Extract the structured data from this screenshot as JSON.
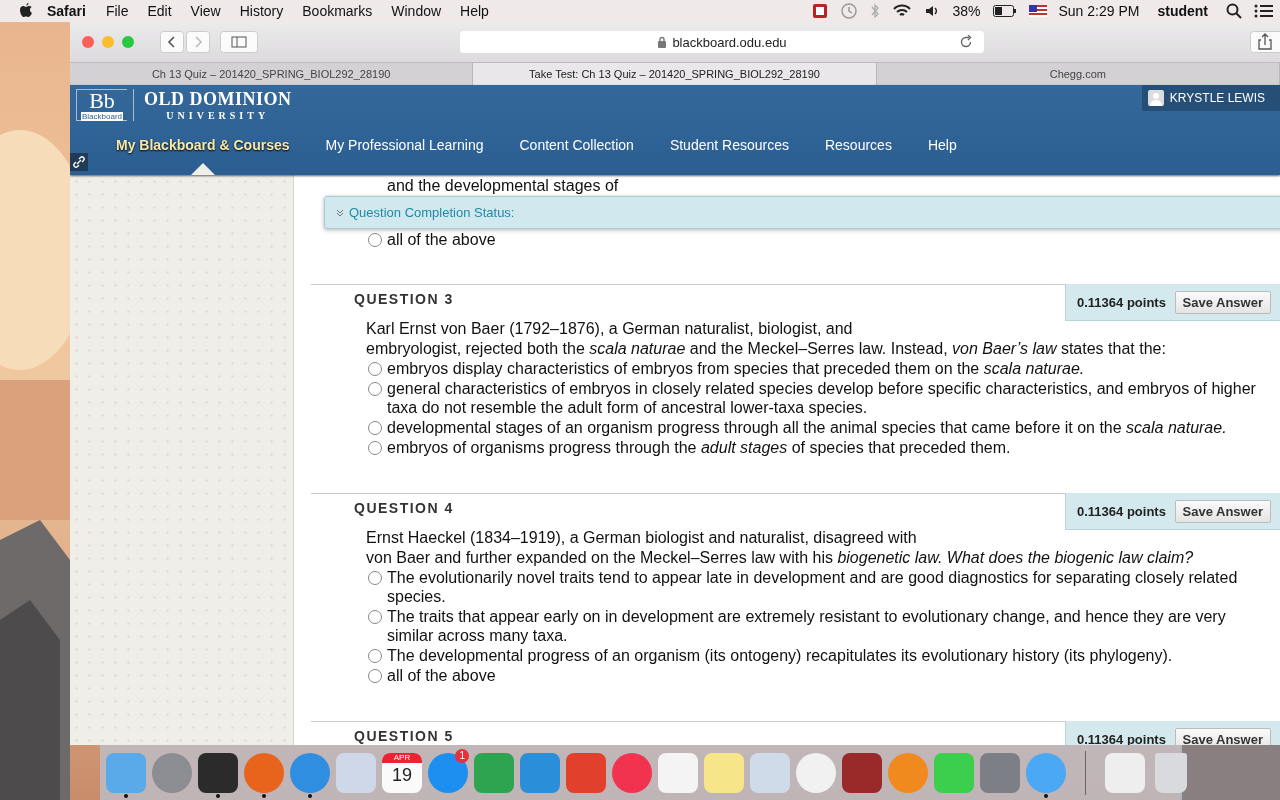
{
  "menu_bar": {
    "app": "Safari",
    "menus": [
      "File",
      "Edit",
      "View",
      "History",
      "Bookmarks",
      "Window",
      "Help"
    ],
    "battery": "38%",
    "clock": "Sun 2:29 PM",
    "user": "student"
  },
  "browser": {
    "address": "blackboard.odu.edu",
    "tabs": [
      {
        "label": "Ch 13 Quiz – 201420_SPRING_BIOL292_28190",
        "selected": false
      },
      {
        "label": "Take Test: Ch 13 Quiz – 201420_SPRING_BIOL292_28190",
        "selected": true
      },
      {
        "label": "Chegg.com",
        "selected": false
      }
    ]
  },
  "site_header": {
    "logo_mark": "Bb",
    "logo_caption": "Blackboard",
    "university": "OLD DOMINION",
    "university_line2": "UNIVERSITY",
    "user_name": "KRYSTLE LEWIS",
    "nav": [
      {
        "label": "My Blackboard & Courses",
        "selected": true
      },
      {
        "label": "My Professional Learning",
        "selected": false
      },
      {
        "label": "Content Collection",
        "selected": false
      },
      {
        "label": "Student Resources",
        "selected": false
      },
      {
        "label": "Resources",
        "selected": false
      },
      {
        "label": "Help",
        "selected": false
      }
    ]
  },
  "completion_banner": {
    "label": "Question Completion Status:"
  },
  "previous_question": {
    "fragment": "and the developmental stages of",
    "options": [
      {
        "text": "all of the above",
        "selected": false
      }
    ]
  },
  "questions": [
    {
      "title": "QUESTION 3",
      "points": "0.11364 points",
      "save_label": "Save Answer",
      "prompt": [
        "Karl Ernst von Baer (1792–1876), a German naturalist, biologist, and",
        "embryologist, rejected both the *scala naturae* and the Meckel–Serres law. Instead, *von Baer’s law* states that the:"
      ],
      "options": [
        {
          "text": "embryos display characteristics of embryos from species that preceded them on the *scala naturae.*",
          "selected": false
        },
        {
          "text": "general characteristics of embryos in closely related species develop before specific characteristics, and embryos of higher taxa do not resemble the adult form of ancestral lower-taxa species.",
          "selected": false
        },
        {
          "text": "developmental stages of an organism progress through all the animal species that came before it on the *scala naturae.*",
          "selected": false
        },
        {
          "text": "embryos of organisms progress through the *adult stages* of species that preceded them.",
          "selected": false
        }
      ]
    },
    {
      "title": "QUESTION 4",
      "points": "0.11364 points",
      "save_label": "Save Answer",
      "prompt": [
        "Ernst Haeckel (1834–1919), a German biologist and naturalist, disagreed with",
        "von Baer and further expanded on the Meckel–Serres law with his *biogenetic law. What does the biogenic law claim?*"
      ],
      "options": [
        {
          "text": "The evolutionarily novel traits tend to appear late in development and are good diagnostics for separating closely related species.",
          "selected": false
        },
        {
          "text": "The traits that appear early on in development are extremely resistant to evolutionary change, and hence they are very similar across many taxa.",
          "selected": false
        },
        {
          "text": "The developmental progress of an organism (its ontogeny) recapitulates its evolutionary history (its phylogeny).",
          "selected": false
        },
        {
          "text": "all of the above",
          "selected": false
        }
      ]
    },
    {
      "title": "QUESTION 5",
      "points": "0.11364 points",
      "save_label": "Save Answer"
    }
  ],
  "dock": {
    "items": [
      {
        "kind": "finder",
        "running": true
      },
      {
        "kind": "rocket",
        "running": false
      },
      {
        "kind": "dashboard",
        "running": true
      },
      {
        "kind": "firefox",
        "running": true
      },
      {
        "kind": "compass",
        "running": true
      },
      {
        "kind": "stamp",
        "running": false
      },
      {
        "kind": "calendar",
        "running": false,
        "month": "APR",
        "day": "19"
      },
      {
        "kind": "appstore",
        "running": false,
        "badge": "1"
      },
      {
        "kind": "green",
        "running": false
      },
      {
        "kind": "blue",
        "running": false
      },
      {
        "kind": "red",
        "running": false
      },
      {
        "kind": "music",
        "running": false
      },
      {
        "kind": "list",
        "running": false
      },
      {
        "kind": "notes",
        "running": false
      },
      {
        "kind": "preview",
        "running": false
      },
      {
        "kind": "photos",
        "running": false
      },
      {
        "kind": "photobooth",
        "running": false
      },
      {
        "kind": "book",
        "running": false
      },
      {
        "kind": "facetime",
        "running": false
      },
      {
        "kind": "gear",
        "running": false
      },
      {
        "kind": "chat",
        "running": true
      },
      {
        "kind": "separator"
      },
      {
        "kind": "document",
        "running": false
      },
      {
        "kind": "trash",
        "running": false
      }
    ]
  }
}
